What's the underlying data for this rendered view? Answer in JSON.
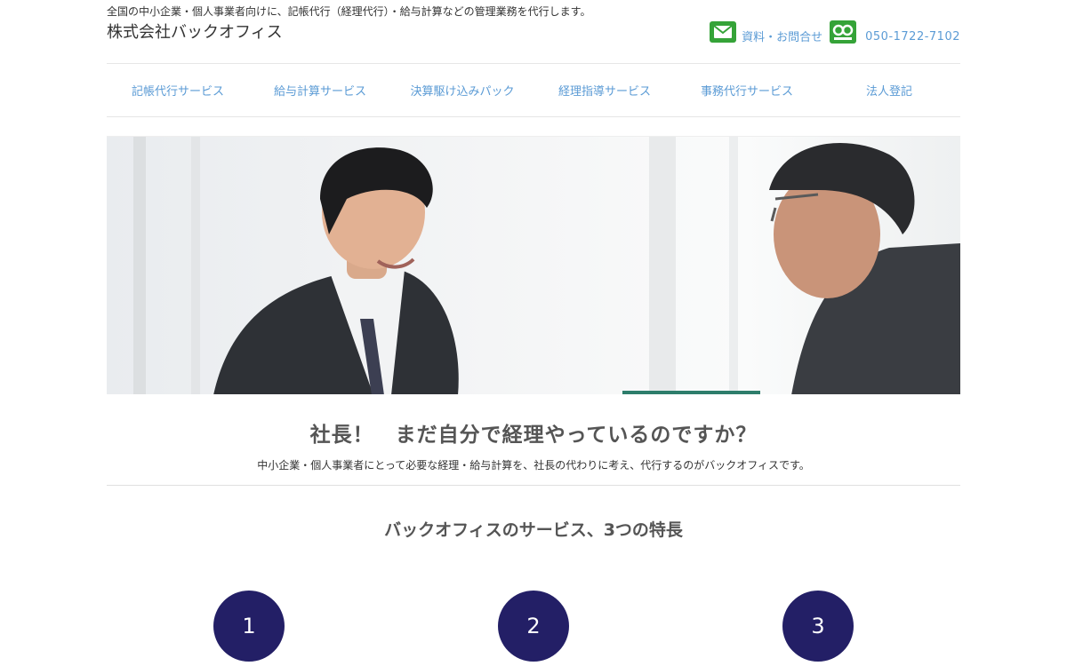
{
  "header": {
    "tagline": "全国の中小企業・個人事業者向けに、記帳代行（経理代行）・給与計算などの管理業務を代行します。",
    "company_name": "株式会社バックオフィス",
    "contact_label": "資料・お問合せ",
    "phone_number": "050-1722-7102",
    "mail_icon": "mail-icon",
    "phone_icon": "free-dial-icon"
  },
  "nav": {
    "items": [
      {
        "label": "記帳代行サービス"
      },
      {
        "label": "給与計算サービス"
      },
      {
        "label": "決算駆け込みパック"
      },
      {
        "label": "経理指導サービス"
      },
      {
        "label": "事務代行サービス"
      },
      {
        "label": "法人登記"
      }
    ]
  },
  "main": {
    "headline": "社長！　まだ自分で経理やっているのですか？",
    "subline": "中小企業・個人事業者にとって必要な経理・給与計算を、社長の代わりに考え、代行するのがバックオフィスです。",
    "features_title": "バックオフィスのサービス、3つの特長",
    "features": [
      {
        "number": "1"
      },
      {
        "number": "2"
      },
      {
        "number": "3"
      }
    ]
  },
  "colors": {
    "accent_link": "#5b9bd5",
    "icon_green": "#35a338",
    "badge_navy": "#231f66"
  }
}
